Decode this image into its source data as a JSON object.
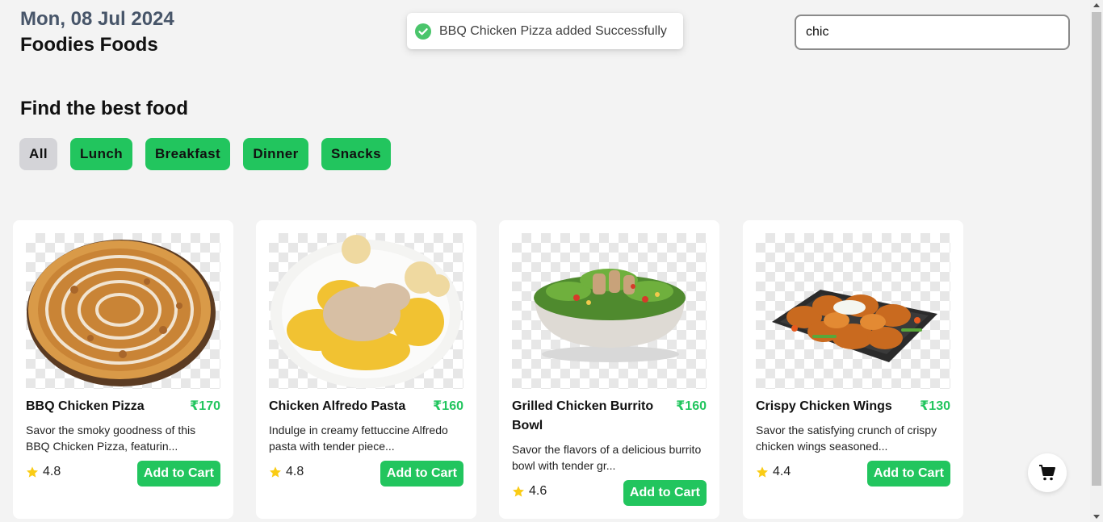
{
  "header": {
    "date": "Mon, 08 Jul 2024",
    "brand": "Foodies Foods"
  },
  "toast": {
    "message": "BBQ Chicken Pizza added Successfully",
    "icon": "check-circle-icon",
    "color": "#22c55e"
  },
  "search": {
    "value": "chic"
  },
  "section": {
    "heading": "Find the best food"
  },
  "filters": [
    {
      "label": "All",
      "active": true
    },
    {
      "label": "Lunch",
      "active": false
    },
    {
      "label": "Breakfast",
      "active": false
    },
    {
      "label": "Dinner",
      "active": false
    },
    {
      "label": "Snacks",
      "active": false
    }
  ],
  "products": [
    {
      "name": "BBQ Chicken Pizza",
      "price": "₹170",
      "description": "Savor the smoky goodness of this BBQ Chicken Pizza, featurin...",
      "rating": "4.8",
      "button": "Add to Cart"
    },
    {
      "name": "Chicken Alfredo Pasta",
      "price": "₹160",
      "description": "Indulge in creamy fettuccine Alfredo pasta with tender piece...",
      "rating": "4.8",
      "button": "Add to Cart"
    },
    {
      "name": "Grilled Chicken Burrito Bowl",
      "price": "₹160",
      "description": "Savor the flavors of a delicious burrito bowl with tender gr...",
      "rating": "4.6",
      "button": "Add to Cart"
    },
    {
      "name": "Crispy Chicken Wings",
      "price": "₹130",
      "description": "Savor the satisfying crunch of crispy chicken wings seasoned...",
      "rating": "4.4",
      "button": "Add to Cart"
    }
  ],
  "cart": {
    "icon": "shopping-cart-icon"
  },
  "colors": {
    "accent": "#22c55e",
    "background": "#f3f3f3",
    "star": "#facc15"
  }
}
